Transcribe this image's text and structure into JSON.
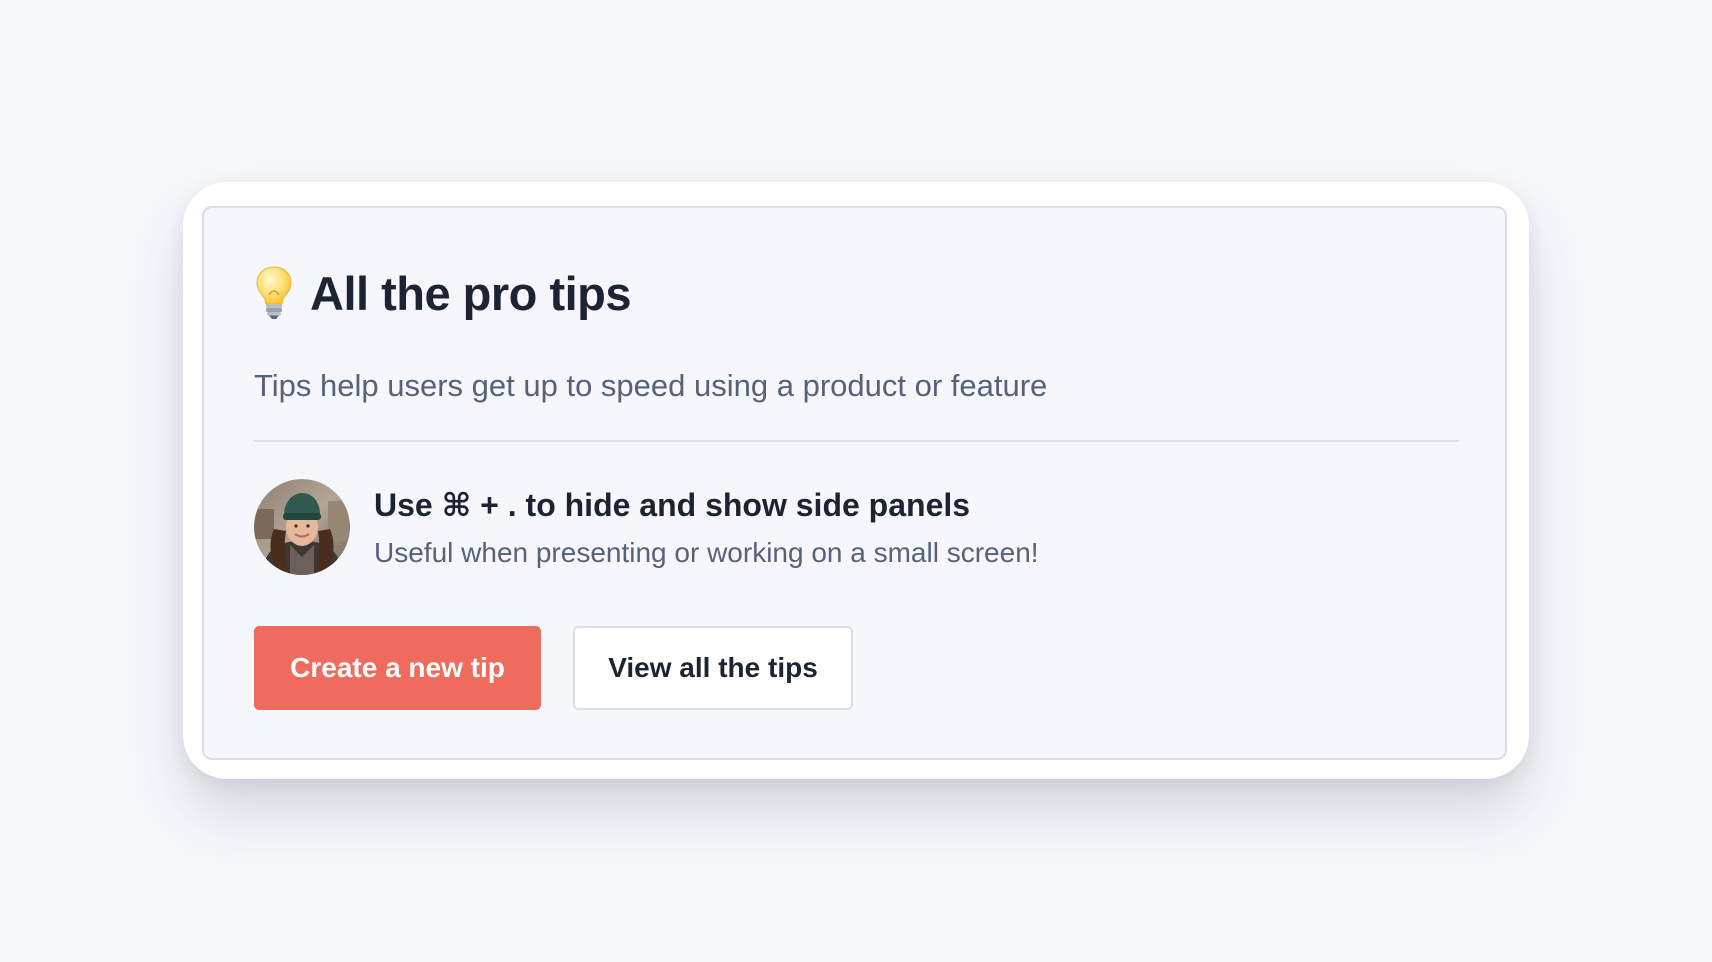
{
  "card": {
    "icon": "lightbulb-icon",
    "title": "All the pro tips",
    "subtitle": "Tips help users get up to speed using a product or feature"
  },
  "tip": {
    "avatar": "user-avatar-photo",
    "title": "Use ⌘ + . to hide and show side panels",
    "description": "Useful when presenting or working on a small screen!"
  },
  "actions": {
    "primary_label": "Create a new tip",
    "secondary_label": "View all the tips"
  },
  "colors": {
    "background": "#f7f8fc",
    "card": "#ffffff",
    "panel": "#f5f7fc",
    "primary": "#ee6b5d",
    "text": "#1c2433",
    "muted_text": "#56617a",
    "border": "#d8dee9"
  }
}
